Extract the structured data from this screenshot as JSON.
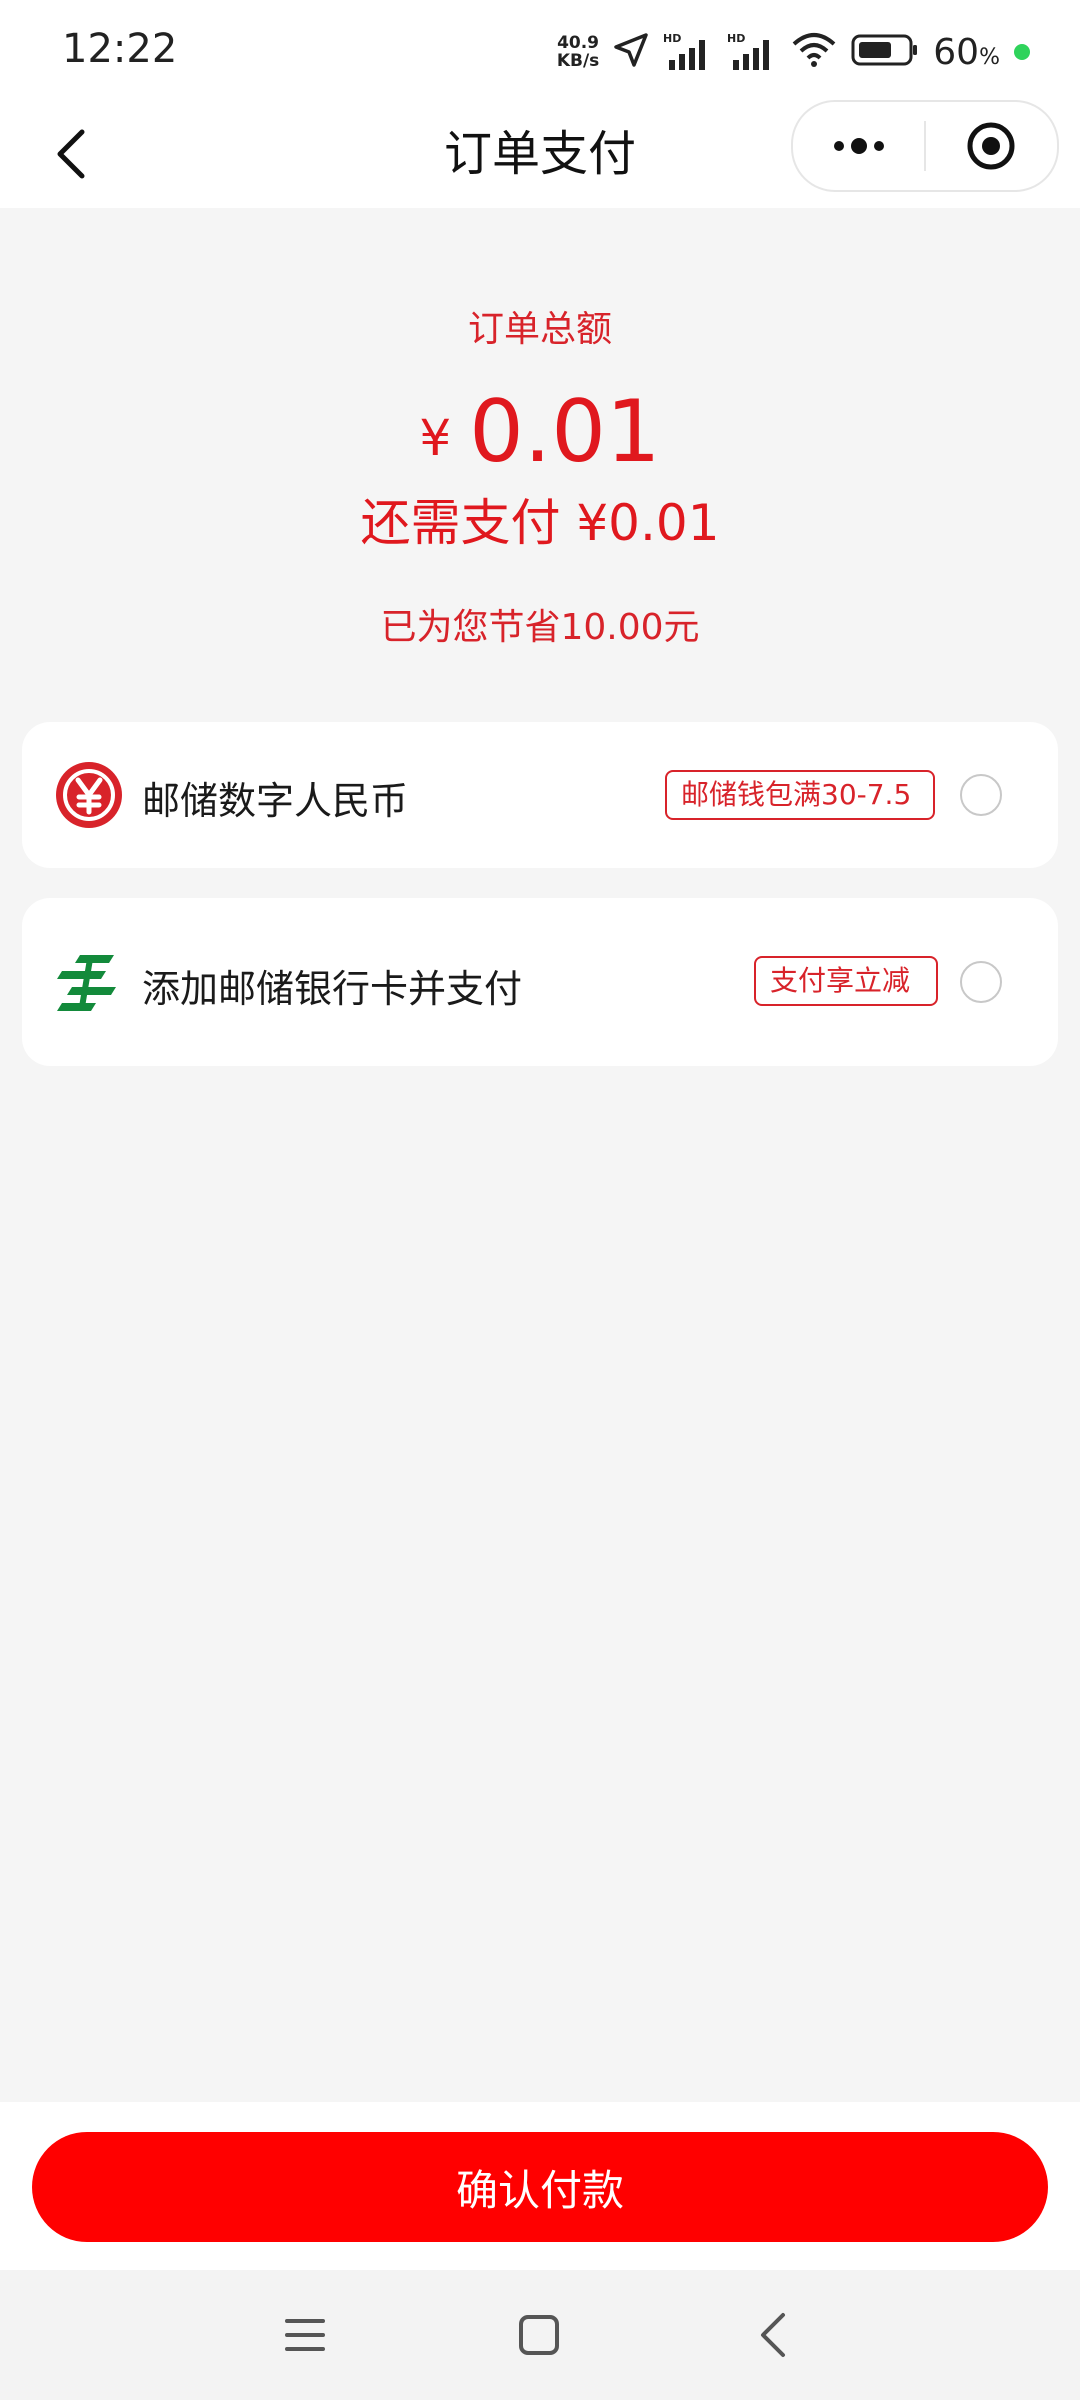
{
  "status_bar": {
    "time": "12:22",
    "net_speed_value": "40.9",
    "net_speed_unit": "KB/s",
    "signal_1_label": "HD",
    "signal_2_label": "HD",
    "battery_value": "60",
    "battery_unit": "%"
  },
  "nav": {
    "title": "订单支付"
  },
  "amount": {
    "label": "订单总额",
    "currency": "¥",
    "total": "0.01",
    "due_text": "还需支付 ¥0.01",
    "savings_text": "已为您节省10.00元"
  },
  "payment_methods": [
    {
      "name": "邮储数字人民币",
      "promo": "邮储钱包满30-7.5",
      "icon": "digital-rmb-icon",
      "selected": false
    },
    {
      "name": "添加邮储银行卡并支付",
      "promo": "支付享立减",
      "icon": "china-post-icon",
      "selected": false
    }
  ],
  "footer": {
    "confirm_label": "确认付款"
  },
  "colors": {
    "accent_red": "#e0181e",
    "button_red": "#ff0000",
    "post_green": "#138a3b",
    "status_green": "#2fd35b"
  }
}
